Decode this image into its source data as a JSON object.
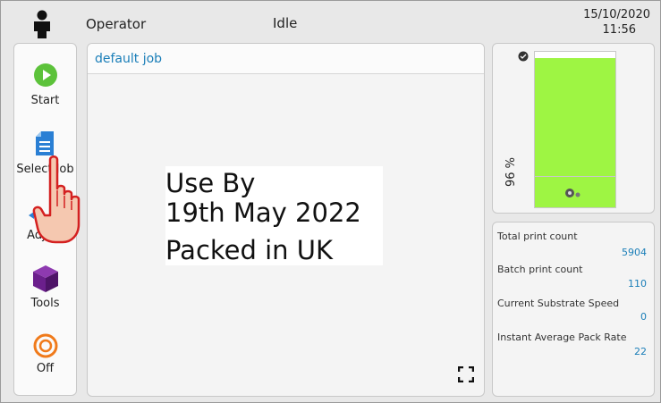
{
  "header": {
    "user": "Operator",
    "status": "Idle",
    "date": "15/10/2020",
    "time": "11:56"
  },
  "sidebar": {
    "items": [
      {
        "label": "Start",
        "icon": "play-icon"
      },
      {
        "label": "Select Job",
        "icon": "document-icon"
      },
      {
        "label": "Adjust",
        "icon": "adjust-icon"
      },
      {
        "label": "Tools",
        "icon": "cube-icon"
      },
      {
        "label": "Off",
        "icon": "power-icon"
      }
    ]
  },
  "job": {
    "name": "default job",
    "preview_lines": [
      "Use By",
      "19th May 2022",
      "Packed in UK"
    ]
  },
  "ink": {
    "level_text": "96 %",
    "level_fraction": 0.96,
    "fill_color": "#9ef543"
  },
  "stats": [
    {
      "label": "Total print count",
      "value": "5904"
    },
    {
      "label": "Batch print count",
      "value": "110"
    },
    {
      "label": "Current Substrate Speed",
      "value": "0"
    },
    {
      "label": "Instant Average Pack Rate",
      "value": "22"
    }
  ],
  "colors": {
    "accent": "#1a7eb8",
    "start_green": "#5cc23a",
    "select_blue": "#2a7fd4",
    "tools_purple": "#6b1f8c",
    "off_orange": "#f07a1a"
  }
}
